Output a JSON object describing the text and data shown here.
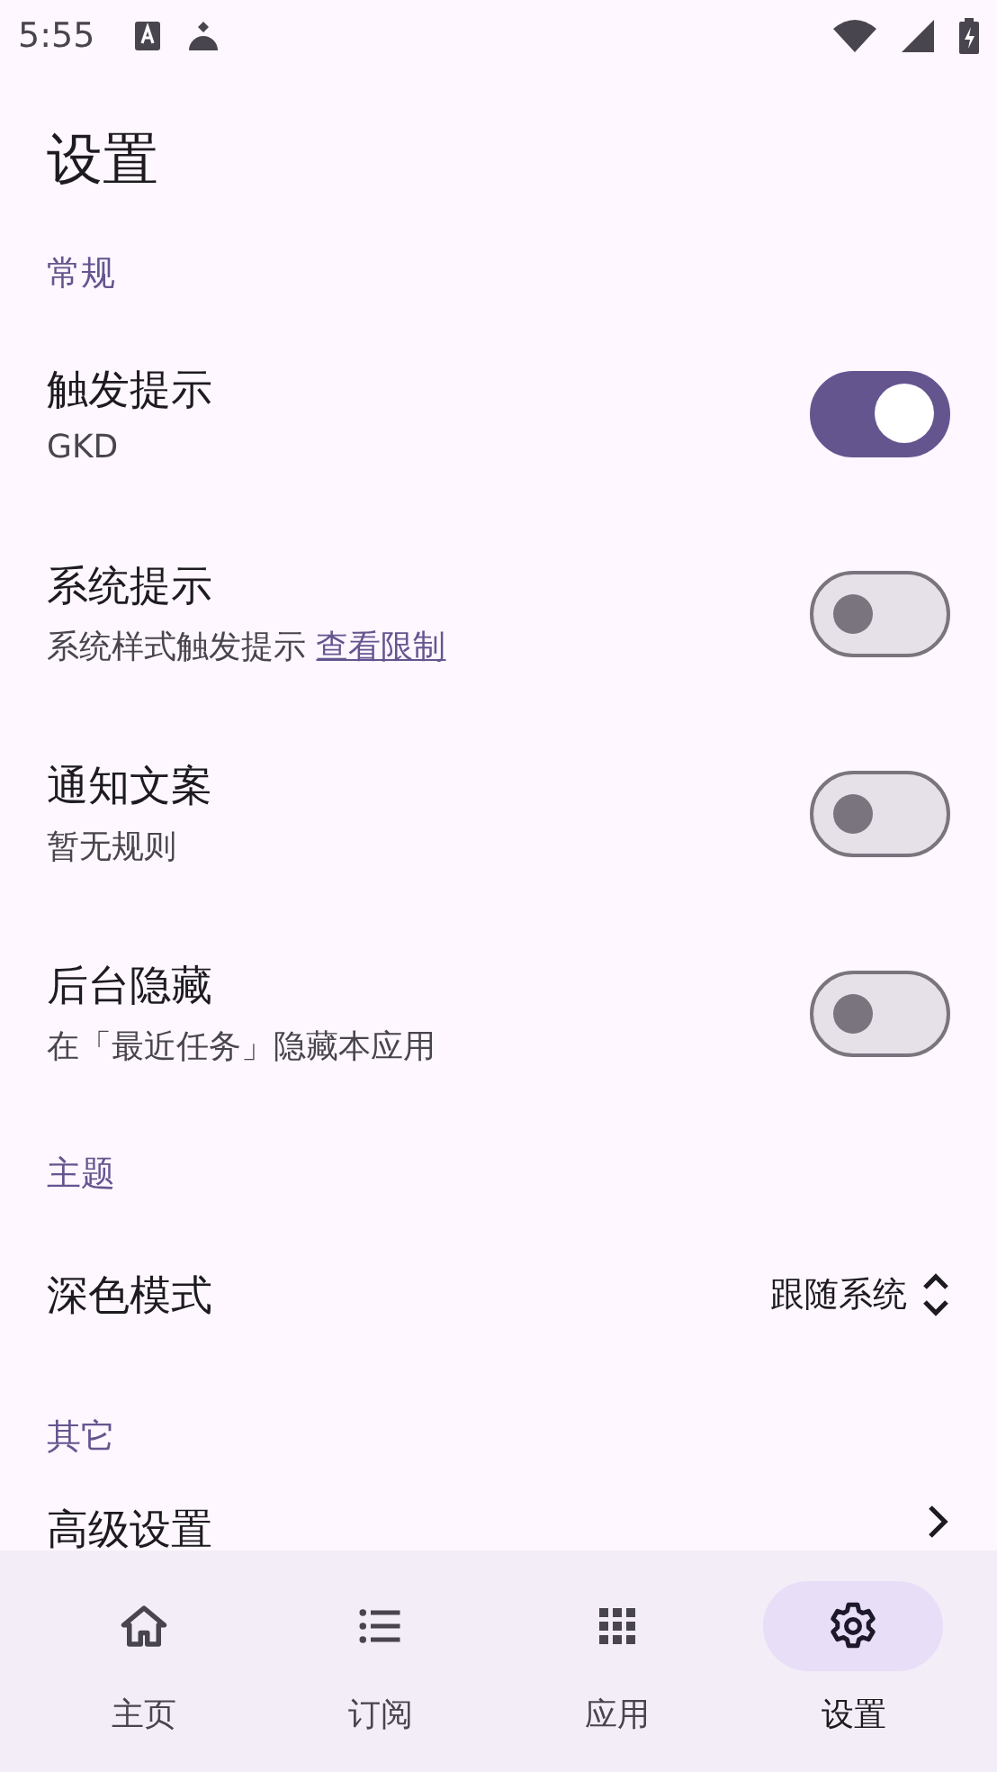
{
  "status_bar": {
    "time": "5:55"
  },
  "title": "设置",
  "sections": [
    {
      "header": "常规",
      "items": [
        {
          "kind": "switch",
          "title": "触发提示",
          "subtitle": "GKD",
          "on": true
        },
        {
          "kind": "switch",
          "title": "系统提示",
          "subtitle": "系统样式触发提示",
          "link": "查看限制",
          "on": false
        },
        {
          "kind": "switch",
          "title": "通知文案",
          "subtitle": "暂无规则",
          "on": false
        },
        {
          "kind": "switch",
          "title": "后台隐藏",
          "subtitle": "在「最近任务」隐藏本应用",
          "on": false
        }
      ]
    },
    {
      "header": "主题",
      "items": [
        {
          "kind": "select",
          "title": "深色模式",
          "value": "跟随系统"
        }
      ]
    },
    {
      "header": "其它",
      "items": [
        {
          "kind": "nav",
          "title": "高级设置"
        }
      ]
    }
  ],
  "nav_bar": [
    {
      "label": "主页",
      "selected": false
    },
    {
      "label": "订阅",
      "selected": false
    },
    {
      "label": "应用",
      "selected": false
    },
    {
      "label": "设置",
      "selected": true
    }
  ]
}
